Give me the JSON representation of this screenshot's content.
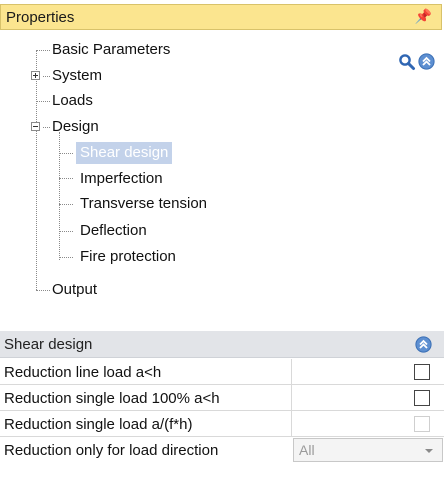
{
  "panel": {
    "title": "Properties",
    "pin_glyph": "ꟼ"
  },
  "tree": {
    "items": [
      {
        "label": "Basic Parameters"
      },
      {
        "label": "System",
        "expander": "plus"
      },
      {
        "label": "Loads"
      },
      {
        "label": "Design",
        "expander": "minus"
      },
      {
        "label": "Shear design",
        "selected": true
      },
      {
        "label": "Imperfection"
      },
      {
        "label": "Transverse tension"
      },
      {
        "label": "Deflection"
      },
      {
        "label": "Fire protection"
      },
      {
        "label": "Output"
      }
    ]
  },
  "icons": {
    "search": "search-icon",
    "collapse": "collapse-up-icon"
  },
  "section": {
    "title": "Shear design",
    "rows": [
      {
        "label": "Reduction line load a<h",
        "checked": false,
        "enabled": true
      },
      {
        "label": "Reduction single load  100% a<h",
        "checked": false,
        "enabled": true
      },
      {
        "label": "Reduction single load  a/(f*h)",
        "checked": false,
        "enabled": false
      },
      {
        "label": "Reduction only for load direction",
        "value": "All",
        "enabled": false
      }
    ]
  },
  "colors": {
    "title_bg": "#fbe58f",
    "selection_bg": "#c3d2ea",
    "section_header_bg": "#e2e4e8",
    "icon_blue": "#3a6fb5"
  }
}
